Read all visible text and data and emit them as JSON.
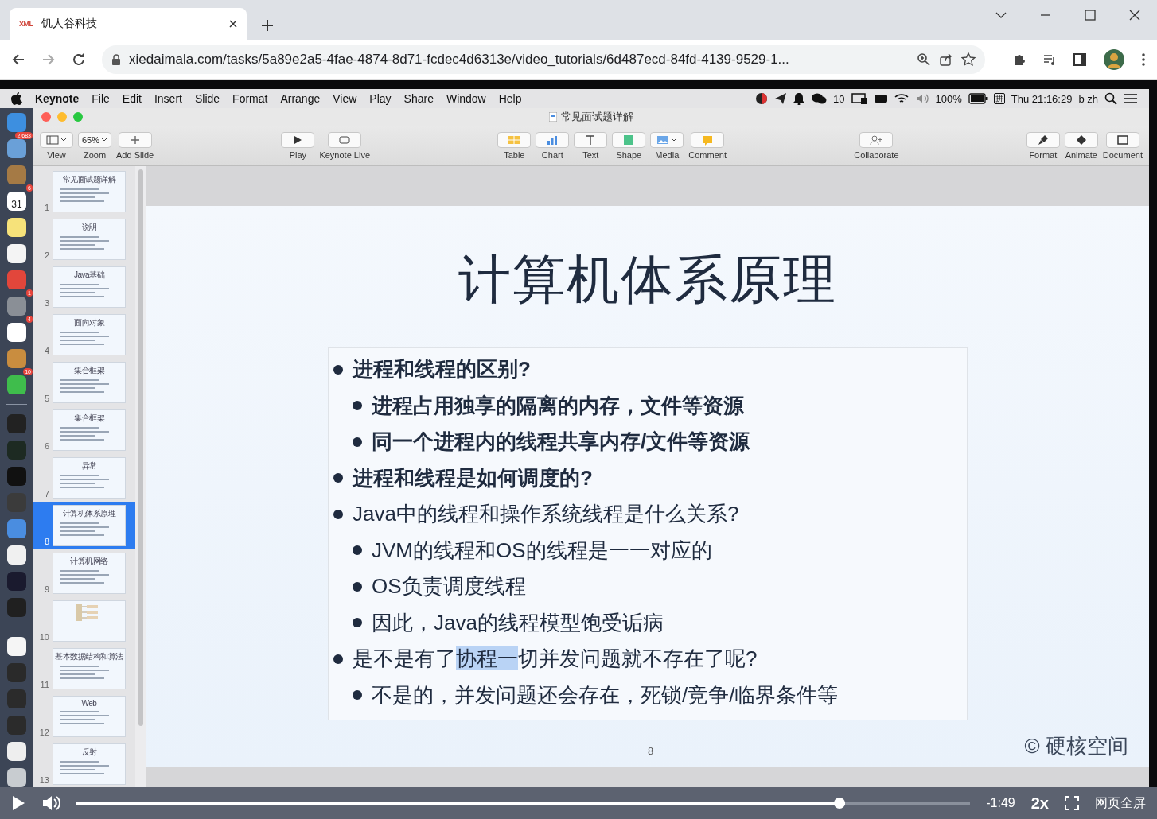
{
  "browser": {
    "tab": {
      "favicon": "XML",
      "title": "饥人谷科技"
    },
    "url": "xiedaimala.com/tasks/5a89e2a5-4fae-4874-8d71-fcdec4d6313e/video_tutorials/6d487ecd-84fd-4139-9529-1..."
  },
  "menubar": {
    "app": "Keynote",
    "menus": [
      "File",
      "Edit",
      "Insert",
      "Slide",
      "Format",
      "Arrange",
      "View",
      "Play",
      "Share",
      "Window",
      "Help"
    ],
    "wechat_count": "10",
    "battery": "100%",
    "input_method": "拼",
    "clock": "Thu 21:16:29",
    "user": "b zh"
  },
  "dock": [
    {
      "kind": "finder"
    },
    {
      "kind": "mail",
      "badge": "2,683"
    },
    {
      "kind": "notebook"
    },
    {
      "kind": "calendar",
      "label": "31",
      "badge": "6"
    },
    {
      "kind": "notes"
    },
    {
      "kind": "reminders"
    },
    {
      "kind": "chrome"
    },
    {
      "kind": "settings",
      "badge": "1"
    },
    {
      "kind": "slack",
      "badge": "4"
    },
    {
      "kind": "pencil"
    },
    {
      "kind": "wechat",
      "badge": "10"
    },
    {
      "kind": "separator"
    },
    {
      "kind": "terminal"
    },
    {
      "kind": "monitor"
    },
    {
      "kind": "qq"
    },
    {
      "kind": "sublime"
    },
    {
      "kind": "keynote"
    },
    {
      "kind": "textedit"
    },
    {
      "kind": "intellij"
    },
    {
      "kind": "obs"
    },
    {
      "kind": "separator"
    },
    {
      "kind": "document"
    },
    {
      "kind": "airplay"
    },
    {
      "kind": "window"
    },
    {
      "kind": "window"
    },
    {
      "kind": "browserwin"
    },
    {
      "kind": "trash"
    }
  ],
  "keynote": {
    "title": "常见面试题详解",
    "toolbar_groups": [
      [
        {
          "kind": "view",
          "label": "View"
        },
        {
          "kind": "zoom",
          "label": "Zoom",
          "value": "65%"
        },
        {
          "kind": "add",
          "label": "Add Slide"
        }
      ],
      [
        {
          "kind": "play",
          "label": "Play"
        },
        {
          "kind": "live",
          "label": "Keynote Live"
        }
      ],
      [
        {
          "kind": "table",
          "label": "Table"
        },
        {
          "kind": "chart",
          "label": "Chart"
        },
        {
          "kind": "text",
          "label": "Text"
        },
        {
          "kind": "shape",
          "label": "Shape"
        },
        {
          "kind": "media",
          "label": "Media"
        },
        {
          "kind": "comment",
          "label": "Comment"
        }
      ],
      [
        {
          "kind": "collaborate",
          "label": "Collaborate"
        }
      ],
      [
        {
          "kind": "format",
          "label": "Format"
        },
        {
          "kind": "animate",
          "label": "Animate"
        },
        {
          "kind": "document",
          "label": "Document"
        }
      ]
    ],
    "slides": [
      {
        "number": "1",
        "title": "常见面试题详解",
        "selected": false
      },
      {
        "number": "2",
        "title": "说明",
        "selected": false
      },
      {
        "number": "3",
        "title": "Java基础",
        "selected": false
      },
      {
        "number": "4",
        "title": "面向对象",
        "selected": false
      },
      {
        "number": "5",
        "title": "集合框架",
        "selected": false
      },
      {
        "number": "6",
        "title": "集合框架",
        "selected": false
      },
      {
        "number": "7",
        "title": "异常",
        "selected": false
      },
      {
        "number": "8",
        "title": "计算机体系原理",
        "selected": true
      },
      {
        "number": "9",
        "title": "计算机网络",
        "selected": false
      },
      {
        "number": "10",
        "kind": "diagram",
        "selected": false
      },
      {
        "number": "11",
        "title": "基本数据结构和算法",
        "selected": false
      },
      {
        "number": "12",
        "title": "Web",
        "selected": false
      },
      {
        "number": "13",
        "title": "反射",
        "selected": false
      }
    ],
    "slide": {
      "title": "计算机体系原理",
      "bullets": [
        {
          "text": "进程和线程的区别?",
          "bold": true,
          "children": [
            {
              "text": "进程占用独享的隔离的内存，文件等资源",
              "bold": true
            },
            {
              "text": "同一个进程内的线程共享内存/文件等资源",
              "bold": true
            }
          ]
        },
        {
          "text": "进程和线程是如何调度的?",
          "bold": true
        },
        {
          "text": "Java中的线程和操作系统线程是什么关系?",
          "bold": false,
          "children": [
            {
              "text": "JVM的线程和OS的线程是一一对应的",
              "bold": false
            },
            {
              "text": "OS负责调度线程",
              "bold": false
            },
            {
              "text": "因此，Java的线程模型饱受诟病",
              "bold": false
            }
          ]
        },
        {
          "parts": [
            {
              "text": "是不是有了",
              "selected": false
            },
            {
              "text": "协程一",
              "selected": true
            },
            {
              "text": "切并发问题就不存在了呢?",
              "selected": false
            }
          ],
          "bold": false,
          "children": [
            {
              "text": "不是的，并发问题还会存在，死锁/竞争/临界条件等",
              "bold": false
            }
          ]
        }
      ],
      "page_number": "8",
      "credit": "© 硬核空间"
    }
  },
  "player": {
    "remaining": "-1:49",
    "speed": "2x",
    "fullscreen_label": "网页全屏"
  }
}
